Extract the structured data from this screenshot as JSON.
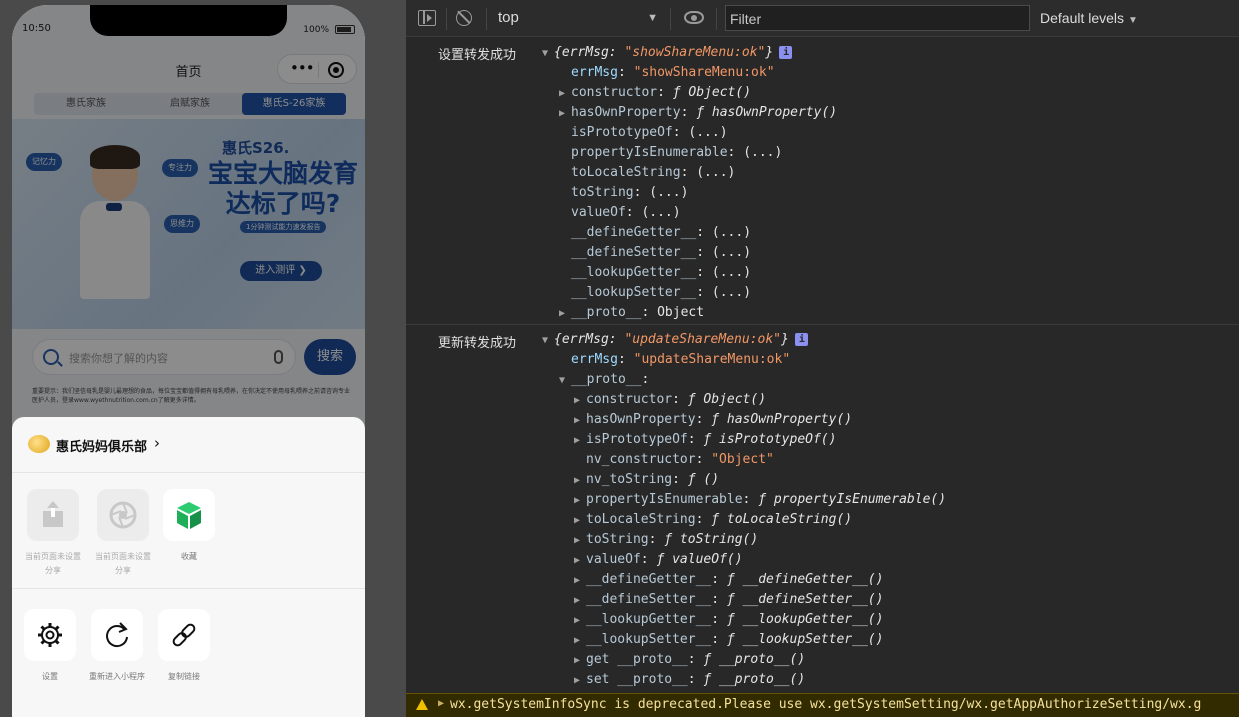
{
  "phone": {
    "status": {
      "time": "10:50",
      "battery": "100%"
    },
    "nav_title": "首页",
    "tabs": [
      "惠氏家族",
      "启赋家族",
      "惠氏S-26家族"
    ],
    "banner": {
      "brand": "惠氏S26.",
      "headline": "宝宝大脑发育达标了吗?",
      "subline": "1分钟测试能力速发报告",
      "cta": "进入测评 ❯",
      "bubbles": [
        "记忆力",
        "专注力",
        "思维力"
      ]
    },
    "search": {
      "placeholder": "搜索你想了解的内容",
      "button": "搜索"
    },
    "disclaimer": "重要提示：我们坚信母乳是婴儿最理想的食品，每位宝宝都值得拥有母乳喂养，在你决定不使用母乳喂养之前请咨询专业医护人员，登录www.wyethnutrition.com.cn了解更多详情。",
    "sheet": {
      "club_name": "惠氏妈妈俱乐部",
      "chevron": "›",
      "row1": [
        {
          "label": "当前页面未设置分享",
          "icon": "share-icon",
          "disabled": true
        },
        {
          "label": "当前页面未设置分享",
          "icon": "moments-icon",
          "disabled": true
        },
        {
          "label": "收藏",
          "icon": "favorite-cube-icon",
          "disabled": false
        }
      ],
      "row2": [
        {
          "label": "设置",
          "icon": "gear-icon"
        },
        {
          "label": "重新进入小程序",
          "icon": "reload-icon"
        },
        {
          "label": "复制链接",
          "icon": "link-icon"
        }
      ]
    }
  },
  "devtools": {
    "context": "top",
    "filter_placeholder": "Filter",
    "levels": "Default levels",
    "messages": [
      {
        "label": "设置转发成功",
        "summary_value": "showShareMenu:ok"
      },
      {
        "label": "更新转发成功",
        "summary_value": "updateShareMenu:ok"
      }
    ],
    "warning": "wx.getSystemInfoSync is deprecated.Please use wx.getSystemSetting/wx.getAppAuthorizeSetting/wx.g",
    "accent_colors": {
      "key": "#9fd9ff",
      "string": "#f29766",
      "warning_bg": "#332b00"
    }
  }
}
